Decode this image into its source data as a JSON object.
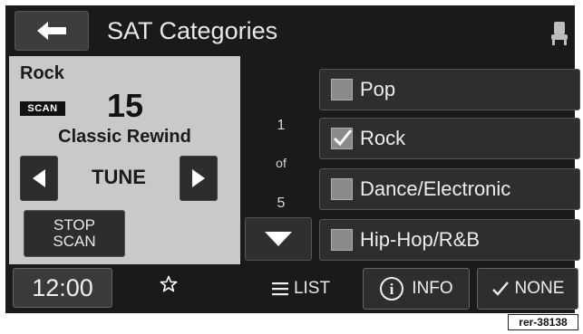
{
  "header": {
    "title": "SAT Categories",
    "back_icon": "back-arrow-icon",
    "seat_icon": "seat-icon"
  },
  "now_playing": {
    "genre": "Rock",
    "scan_badge": "SCAN",
    "channel": "15",
    "station": "Classic Rewind"
  },
  "tune": {
    "label": "TUNE",
    "prev_icon": "triangle-left-icon",
    "next_icon": "triangle-right-icon"
  },
  "stop_scan": {
    "line1": "STOP",
    "line2": "SCAN"
  },
  "clock": "12:00",
  "favorite_icon": "star-outline-icon",
  "pager": {
    "current": "1",
    "of": "of",
    "total": "5",
    "down_icon": "triangle-down-icon"
  },
  "categories": [
    {
      "label": "Pop",
      "checked": false
    },
    {
      "label": "Rock",
      "checked": true
    },
    {
      "label": "Dance/Electronic",
      "checked": false
    },
    {
      "label": "Hip-Hop/R&B",
      "checked": false
    }
  ],
  "bottom": {
    "list_label": "LIST",
    "info_label": "INFO",
    "none_label": "NONE"
  },
  "ref_tag": "rer-38138",
  "colors": {
    "screen": "#1a1a1a",
    "panel": "#c9c9c9",
    "button": "#2e2e2e",
    "text": "#ececec"
  }
}
